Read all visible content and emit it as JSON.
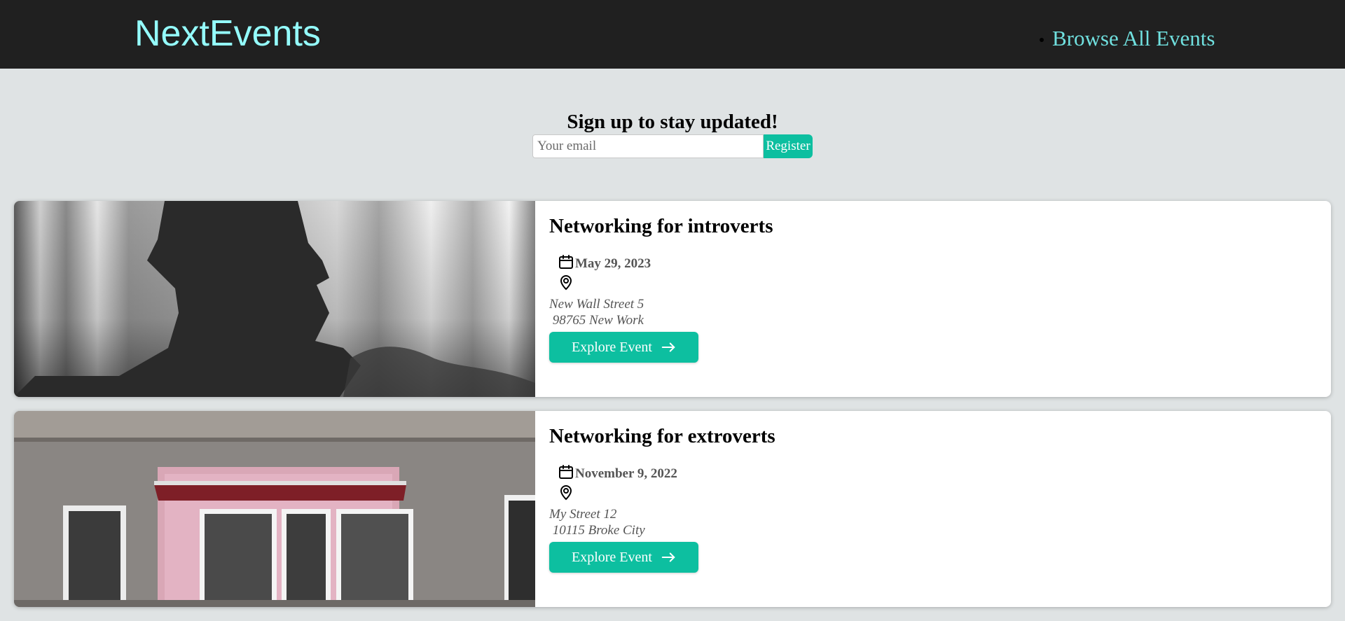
{
  "header": {
    "logo": "NextEvents",
    "nav": [
      {
        "label": "Browse All Events"
      }
    ]
  },
  "signup": {
    "heading": "Sign up to stay updated!",
    "email_placeholder": "Your email",
    "email_value": "",
    "register_label": "Register"
  },
  "events": [
    {
      "title": "Networking for introverts",
      "date": "May 29, 2023",
      "address": "New Wall Street 5\n 98765 New Work",
      "button_label": "Explore Event",
      "image_icon": "silhouette-photo"
    },
    {
      "title": "Networking for extroverts",
      "date": "November 9, 2022",
      "address": "My Street 12\n 10115 Broke City",
      "button_label": "Explore Event",
      "image_icon": "storefront-photo"
    }
  ],
  "colors": {
    "header_bg": "#202020",
    "logo": "#94fdfd",
    "nav_link": "#70e0df",
    "page_bg": "#dfe3e4",
    "accent": "#0dbfa0"
  }
}
